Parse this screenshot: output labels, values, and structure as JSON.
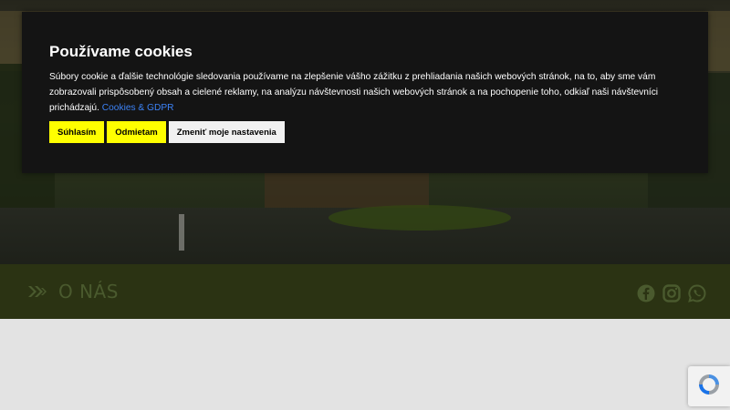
{
  "cookie_banner": {
    "title": "Používame cookies",
    "text": "Súbory cookie a ďalšie technológie sledovania používame na zlepšenie vášho zážitku z prehliadania našich webových stránok, na to, aby sme vám zobrazovali prispôsobený obsah a cielené reklamy, na analýzu návštevnosti našich webových stránok a na pochopenie toho, odkiaľ naši návštevníci prichádzajú.",
    "link": "Cookies & GDPR",
    "accept_label": "Súhlasím",
    "reject_label": "Odmietam",
    "settings_label": "Zmeniť moje nastavenia"
  },
  "section": {
    "title": "O NÁS",
    "arrow_icon": "double-chevron-right-icon"
  },
  "social": {
    "icons": [
      "facebook-icon",
      "instagram-icon",
      "whatsapp-icon"
    ]
  },
  "colors": {
    "accent_yellow": "#ffff00",
    "modal_bg": "#141414",
    "link_blue": "#3c82f6",
    "section_bar": "#2b3313"
  }
}
